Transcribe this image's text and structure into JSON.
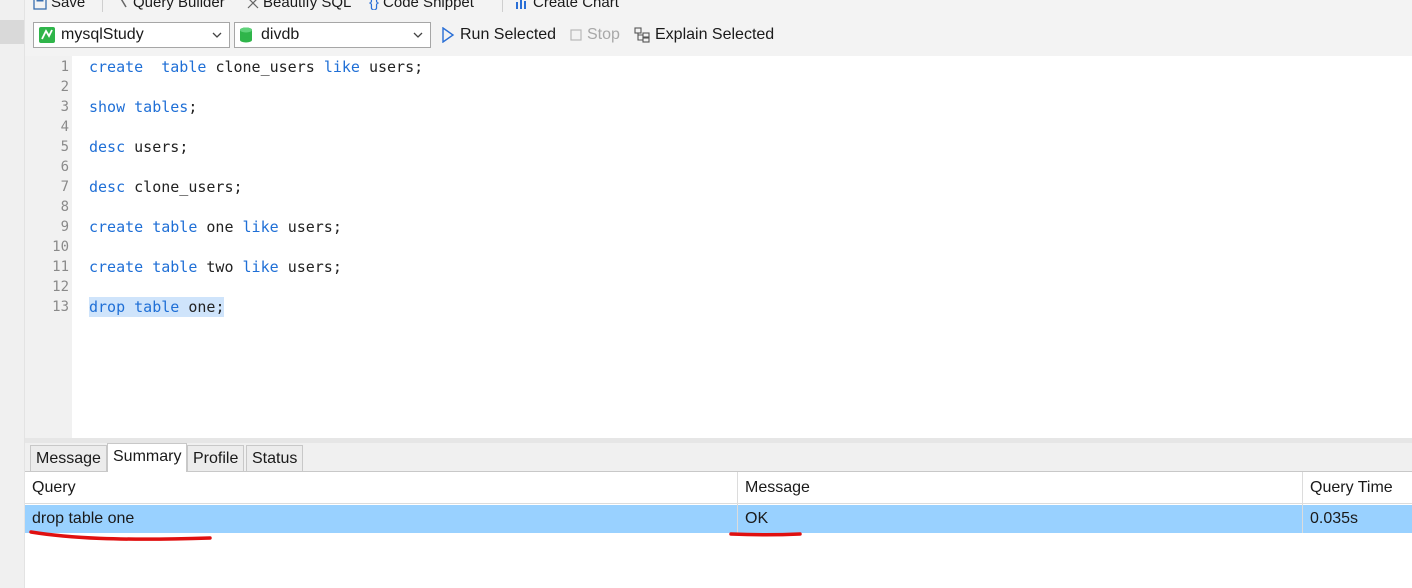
{
  "toolbar": {
    "save": "Save",
    "query_builder": "Query Builder",
    "beautify": "Beautify SQL",
    "code_snippet": "Code Snippet",
    "create_chart": "Create Chart",
    "connection": "mysqlStudy",
    "database": "divdb",
    "run_selected": "Run Selected",
    "stop": "Stop",
    "explain_selected": "Explain Selected"
  },
  "editor": {
    "lines": [
      {
        "num": "1",
        "text": "create  table clone_users like users;"
      },
      {
        "num": "2",
        "text": ""
      },
      {
        "num": "3",
        "text": "show tables;"
      },
      {
        "num": "4",
        "text": ""
      },
      {
        "num": "5",
        "text": "desc users;"
      },
      {
        "num": "6",
        "text": ""
      },
      {
        "num": "7",
        "text": "desc clone_users;"
      },
      {
        "num": "8",
        "text": ""
      },
      {
        "num": "9",
        "text": "create table one like users;"
      },
      {
        "num": "10",
        "text": ""
      },
      {
        "num": "11",
        "text": "create table two like users;"
      },
      {
        "num": "12",
        "text": ""
      },
      {
        "num": "13",
        "text": "drop table one;"
      }
    ],
    "selected_line": "13"
  },
  "result_tabs": [
    "Message",
    "Summary",
    "Profile",
    "Status"
  ],
  "active_tab": "Summary",
  "summary": {
    "headers": {
      "query": "Query",
      "message": "Message",
      "time": "Query Time"
    },
    "rows": [
      {
        "query": "drop table one",
        "message": "OK",
        "time": "0.035s"
      }
    ]
  },
  "colors": {
    "keyword": "#1f6fd6",
    "selection_row": "#99d1ff",
    "annotation": "#e01010"
  },
  "icons": [
    "save-icon",
    "query-builder-icon",
    "beautify-icon",
    "code-snippet-icon",
    "create-chart-icon",
    "connection-icon",
    "database-icon",
    "play-icon",
    "stop-icon",
    "explain-icon"
  ]
}
